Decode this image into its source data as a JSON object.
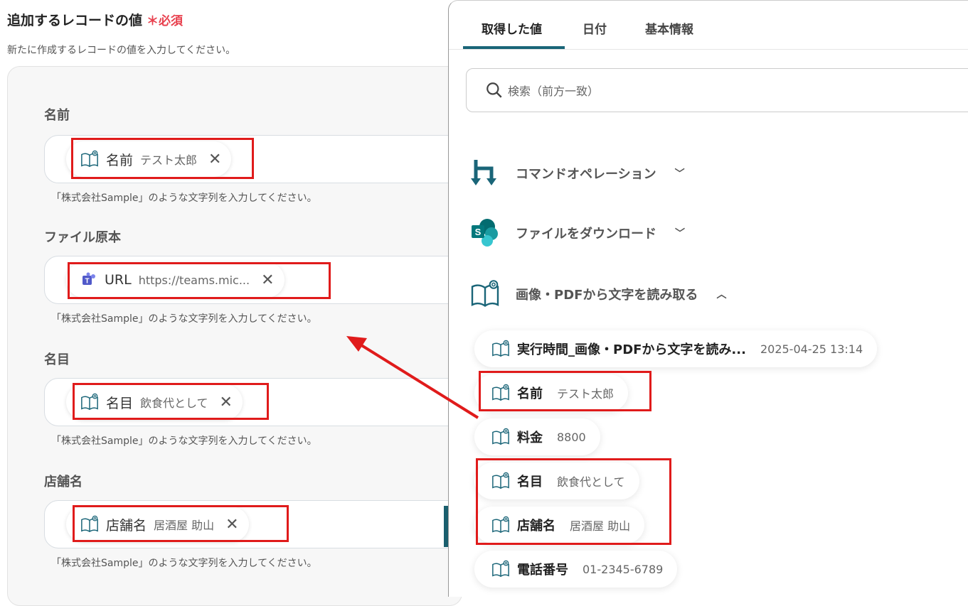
{
  "header": {
    "title": "追加するレコードの値",
    "required": "＊必須",
    "description": "新たに作成するレコードの値を入力してください。"
  },
  "fields": [
    {
      "label": "名前",
      "chip_key": "名前",
      "chip_value": "テスト太郎",
      "icon": "ocr-book-icon",
      "hint": "「株式会社Sample」のような文字列を入力してください。"
    },
    {
      "label": "ファイル原本",
      "chip_key": "URL",
      "chip_value": "https://teams.mic...",
      "icon": "teams-icon",
      "hint": "「株式会社Sample」のような文字列を入力してください。"
    },
    {
      "label": "名目",
      "chip_key": "名目",
      "chip_value": "飲食代として",
      "icon": "ocr-book-icon",
      "hint": "「株式会社Sample」のような文字列を入力してください。"
    },
    {
      "label": "店舗名",
      "chip_key": "店舗名",
      "chip_value": "居酒屋 助山",
      "icon": "ocr-book-icon",
      "hint": "「株式会社Sample」のような文字列を入力してください。"
    }
  ],
  "panel": {
    "tabs": [
      "取得した値",
      "日付",
      "基本情報"
    ],
    "search_placeholder": "検索（前方一致）",
    "groups": [
      {
        "label": "コマンドオペレーション",
        "icon": "command-operation-icon",
        "state": "collapsed"
      },
      {
        "label": "ファイルをダウンロード",
        "icon": "sharepoint-icon",
        "state": "collapsed"
      },
      {
        "label": "画像・PDFから文字を読み取る",
        "icon": "ocr-book-icon",
        "state": "expanded"
      }
    ],
    "items": [
      {
        "key": "実行時間_画像・PDFから文字を読み...",
        "value": "2025-04-25 13:14"
      },
      {
        "key": "名前",
        "value": "テスト太郎"
      },
      {
        "key": "料金",
        "value": "8800"
      },
      {
        "key": "名目",
        "value": "飲食代として"
      },
      {
        "key": "店舗名",
        "value": "居酒屋 助山"
      },
      {
        "key": "電話番号",
        "value": "01-2345-6789"
      }
    ]
  },
  "colors": {
    "accent": "#1a6578",
    "required": "#e8404e",
    "annotation": "#e01b1b"
  }
}
